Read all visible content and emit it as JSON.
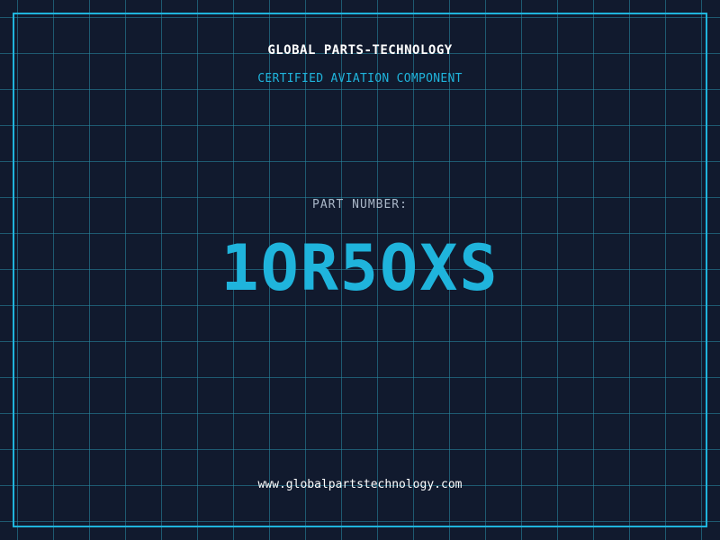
{
  "header": {
    "company": "GLOBAL PARTS-TECHNOLOGY",
    "tagline": "CERTIFIED AVIATION COMPONENT"
  },
  "part": {
    "label": "PART NUMBER:",
    "number": "1OR5OXS"
  },
  "footer": {
    "website": "www.globalpartstechnology.com"
  },
  "colors": {
    "background": "#111a2e",
    "accent": "#1fb4dc",
    "grid": "#288ca5"
  }
}
